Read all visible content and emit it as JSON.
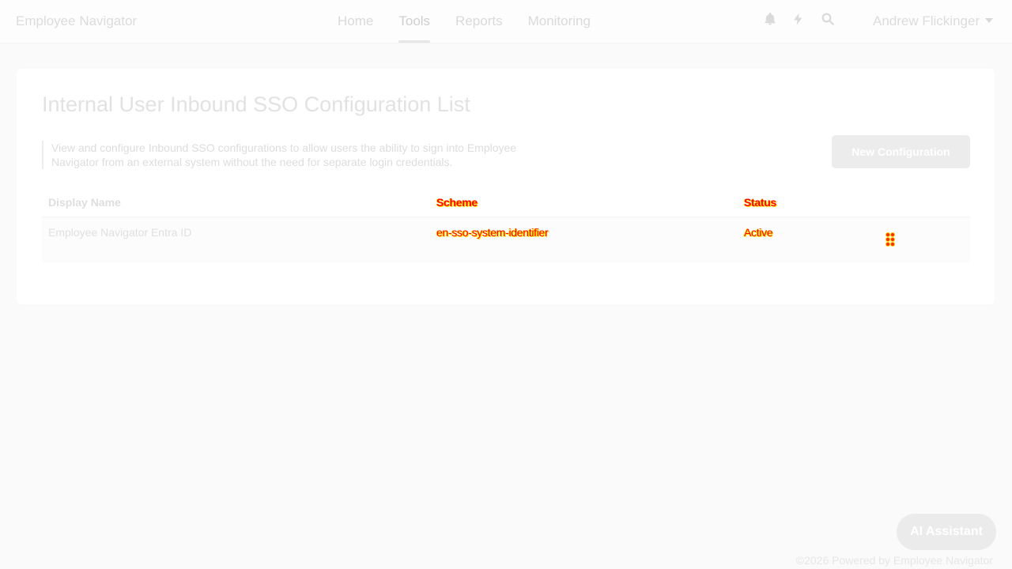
{
  "header": {
    "brand": "Employee Navigator",
    "nav": [
      {
        "label": "Home",
        "active": false
      },
      {
        "label": "Tools",
        "active": true
      },
      {
        "label": "Reports",
        "active": false
      },
      {
        "label": "Monitoring",
        "active": false
      }
    ],
    "icons": [
      "bell-icon",
      "bolt-icon",
      "search-icon"
    ],
    "user_name": "Andrew Flickinger"
  },
  "page": {
    "title": "Internal User Inbound SSO Configuration List",
    "description": "View and configure Inbound SSO configurations to allow users the ability to sign into Employee Navigator from an external system without the need for separate login credentials.",
    "new_button": "New Configuration"
  },
  "table": {
    "columns": [
      "Display Name",
      "Scheme",
      "Status"
    ],
    "rows": [
      {
        "display_name": "Employee Navigator Entra ID",
        "scheme": "en-sso-system-identifier",
        "status": "Active"
      }
    ]
  },
  "ai_button": "AI Assistant",
  "footer": "©2026 Powered by Employee Navigator",
  "colors": {
    "accent": "#ff0000",
    "highlight": "#ffe600"
  }
}
